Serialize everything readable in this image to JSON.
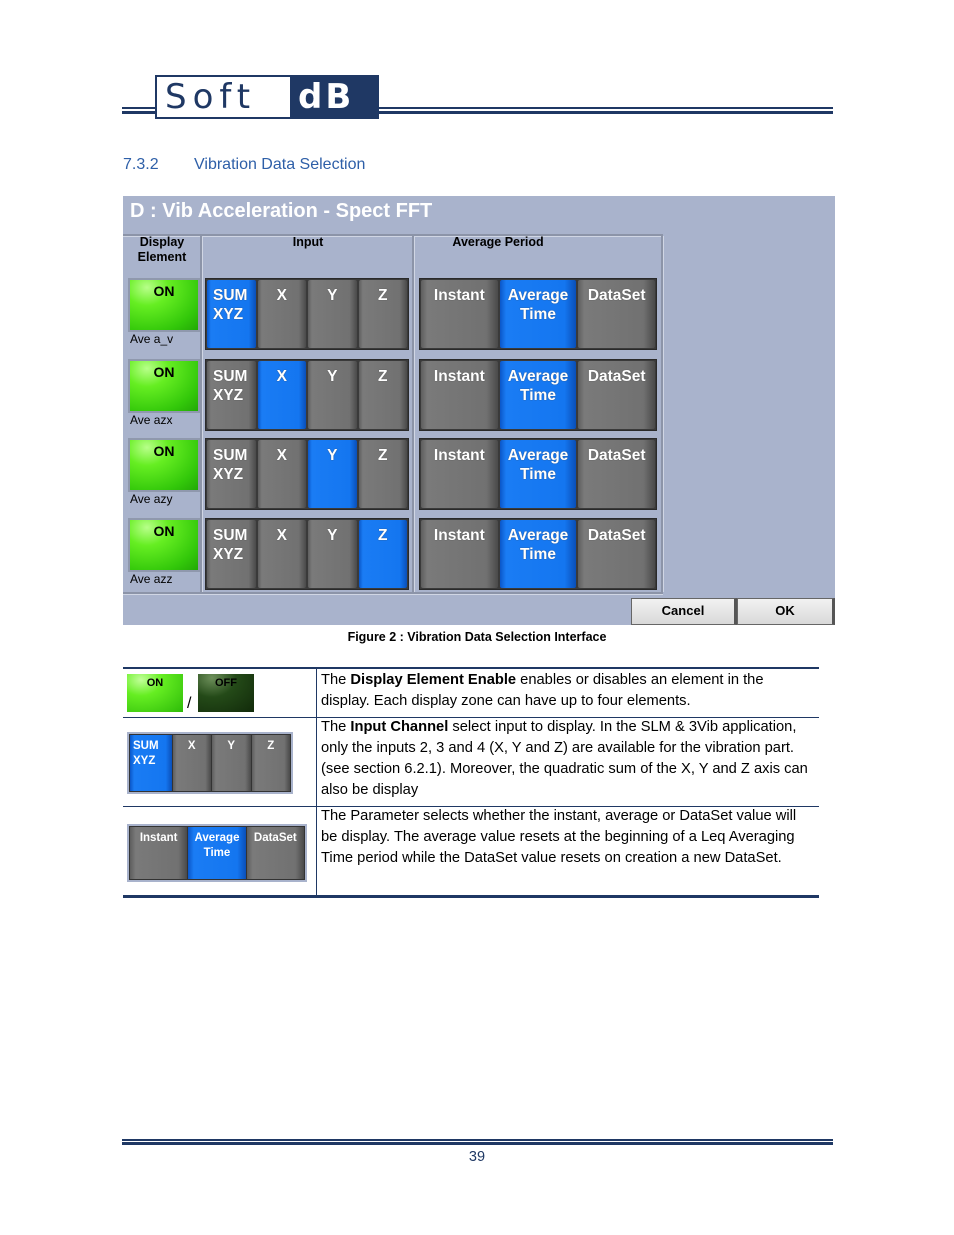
{
  "header": {
    "logo_left": "Soft",
    "logo_right": "dB"
  },
  "section": {
    "number": "7.3.2",
    "title": "Vibration Data Selection"
  },
  "dialog": {
    "title": "D : Vib Acceleration - Spect FFT",
    "columns": {
      "display_element": "Display\nElement",
      "input": "Input",
      "average_period": "Average Period"
    },
    "rows": [
      {
        "toggle": "ON",
        "label": "Ave a_v",
        "inputs": [
          {
            "label": "SUM\nXYZ",
            "selected": true
          },
          {
            "label": "X",
            "selected": false
          },
          {
            "label": "Y",
            "selected": false
          },
          {
            "label": "Z",
            "selected": false
          }
        ],
        "periods": [
          {
            "label": "Instant",
            "selected": false
          },
          {
            "label": "Average\nTime",
            "selected": true
          },
          {
            "label": "DataSet",
            "selected": false
          }
        ]
      },
      {
        "toggle": "ON",
        "label": "Ave azx",
        "inputs": [
          {
            "label": "SUM\nXYZ",
            "selected": false
          },
          {
            "label": "X",
            "selected": true
          },
          {
            "label": "Y",
            "selected": false
          },
          {
            "label": "Z",
            "selected": false
          }
        ],
        "periods": [
          {
            "label": "Instant",
            "selected": false
          },
          {
            "label": "Average\nTime",
            "selected": true
          },
          {
            "label": "DataSet",
            "selected": false
          }
        ]
      },
      {
        "toggle": "ON",
        "label": "Ave azy",
        "inputs": [
          {
            "label": "SUM\nXYZ",
            "selected": false
          },
          {
            "label": "X",
            "selected": false
          },
          {
            "label": "Y",
            "selected": true
          },
          {
            "label": "Z",
            "selected": false
          }
        ],
        "periods": [
          {
            "label": "Instant",
            "selected": false
          },
          {
            "label": "Average\nTime",
            "selected": true
          },
          {
            "label": "DataSet",
            "selected": false
          }
        ]
      },
      {
        "toggle": "ON",
        "label": "Ave azz",
        "inputs": [
          {
            "label": "SUM\nXYZ",
            "selected": false
          },
          {
            "label": "X",
            "selected": false
          },
          {
            "label": "Y",
            "selected": false
          },
          {
            "label": "Z",
            "selected": true
          }
        ],
        "periods": [
          {
            "label": "Instant",
            "selected": false
          },
          {
            "label": "Average\nTime",
            "selected": true
          },
          {
            "label": "DataSet",
            "selected": false
          }
        ]
      }
    ],
    "cancel_label": "Cancel",
    "ok_label": "OK"
  },
  "figure_caption": "Figure 2 : Vibration Data Selection Interface",
  "description_table": {
    "row1": {
      "on_label": "ON",
      "off_label": "OFF",
      "separator": "/",
      "text_pre": "The ",
      "text_bold": "Display Element Enable",
      "text_post": " enables or disables an element in the display. Each display zone can have up to four elements."
    },
    "row2": {
      "buttons": [
        {
          "label": "SUM\nXYZ",
          "selected": true
        },
        {
          "label": "X",
          "selected": false
        },
        {
          "label": "Y",
          "selected": false
        },
        {
          "label": "Z",
          "selected": false
        }
      ],
      "text_pre": "The ",
      "text_bold": "Input Channel",
      "text_post": " select input to display. In the SLM & 3Vib application, only the inputs 2, 3 and 4 (X, Y and Z) are available for the vibration part. (see section 6.2.1). Moreover, the quadratic sum of the X, Y and Z axis can also be display"
    },
    "row3": {
      "buttons": [
        {
          "label": "Instant",
          "selected": false
        },
        {
          "label": "Average\nTime",
          "selected": true
        },
        {
          "label": "DataSet",
          "selected": false
        }
      ],
      "text": "The Parameter selects whether the instant, average or DataSet value will be display. The average value resets at the beginning of a Leq Averaging Time period while the DataSet value resets on creation a new DataSet."
    }
  },
  "footer": {
    "page_number": "39"
  }
}
